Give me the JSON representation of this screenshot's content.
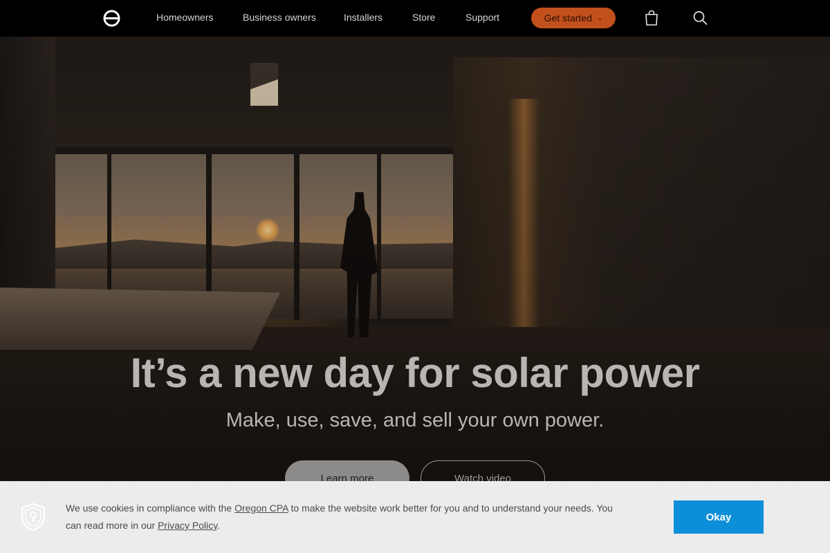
{
  "nav": {
    "logo_icon": "enphase-logo-icon",
    "links": [
      "Homeowners",
      "Business owners",
      "Installers",
      "Store",
      "Support"
    ],
    "cta_label": "Get started",
    "cta_chevron": "⌄",
    "cart_icon": "shopping-bag-icon",
    "search_icon": "search-icon",
    "colors": {
      "background": "#000000",
      "cta": "#c2501d"
    }
  },
  "hero": {
    "title": "It’s a new day for solar power",
    "subtitle": "Make, use, save, and sell your own power.",
    "learn_more_label": "Learn more",
    "watch_video_label": "Watch video"
  },
  "cookie_banner": {
    "icon": "shield-lock-icon",
    "text_before_cpa": "We use cookies in compliance with the ",
    "cpa_link": "Oregon CPA",
    "text_after_cpa": " to make the website work better for you and to understand your needs. You can read more in our ",
    "privacy_link": "Privacy Policy",
    "text_end": ".",
    "okay_label": "Okay",
    "colors": {
      "background": "#ececec",
      "button": "#0d8ed9"
    }
  }
}
